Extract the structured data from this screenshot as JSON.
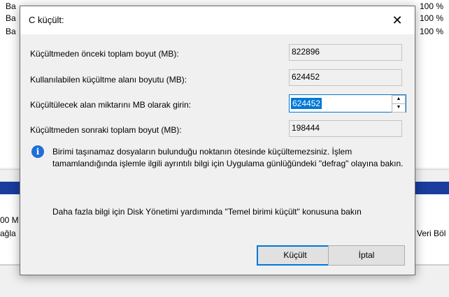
{
  "background": {
    "top_rows": [
      {
        "prefix": "Ba",
        "pct": "100 %"
      },
      {
        "prefix": "Ba",
        "pct": "100 %"
      },
      {
        "prefix": "Ba",
        "pct": "100 %"
      }
    ],
    "left_line1": "00 M",
    "left_line2": "ağla",
    "right_line2": "Veri Böl",
    "paren": ")"
  },
  "dialog": {
    "title": "C küçült:",
    "close_glyph": "✕",
    "fields": {
      "total_before_label": "Küçültmeden önceki toplam boyut (MB):",
      "total_before_value": "822896",
      "available_label": "Kullanılabilen küçültme alanı boyutu (MB):",
      "available_value": "624452",
      "shrink_amount_label": "Küçültülecek alan miktarını MB olarak girin:",
      "shrink_amount_value": "624452",
      "total_after_label": "Küçültmeden sonraki toplam boyut (MB):",
      "total_after_value": "198444"
    },
    "info_icon_glyph": "i",
    "info_text": "Birimi taşınamaz dosyaların bulunduğu noktanın ötesinde küçültemezsiniz. İşlem tamamlandığında işlemle ilgili ayrıntılı bilgi için Uygulama günlüğündeki \"defrag\" olayına bakın.",
    "help_text": "Daha fazla bilgi için Disk Yönetimi yardımında \"Temel birimi küçült\" konusuna bakın",
    "buttons": {
      "shrink": "Küçült",
      "cancel": "İptal"
    },
    "spin_up": "▲",
    "spin_down": "▼"
  },
  "colors": {
    "accent": "#0078d7",
    "disk_band": "#1a3d9e",
    "info_icon": "#1f6fd6"
  }
}
